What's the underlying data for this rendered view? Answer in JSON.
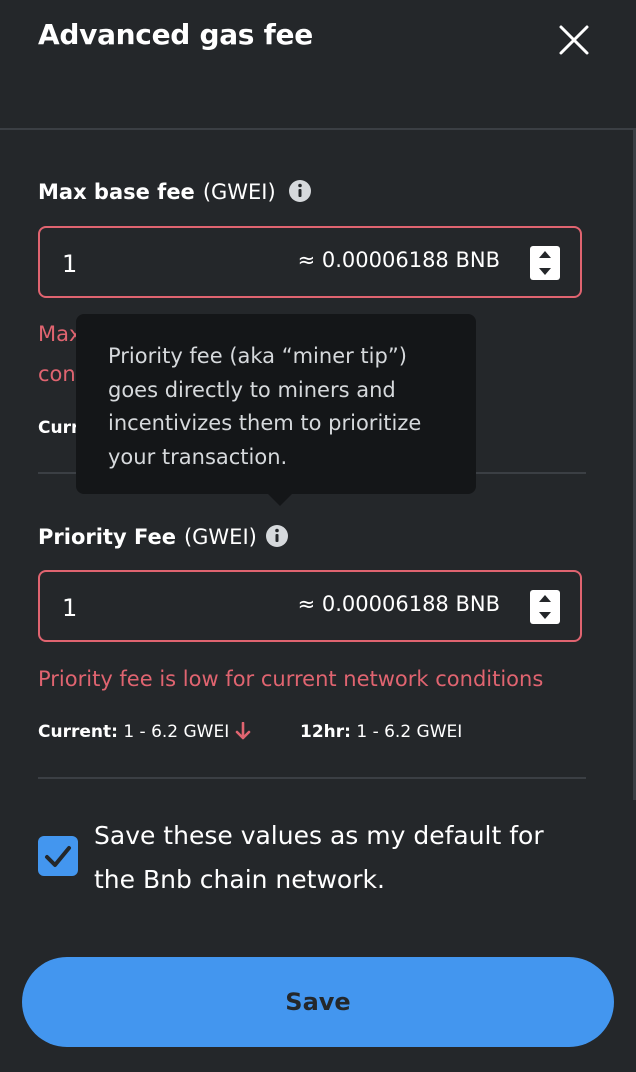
{
  "header": {
    "title": "Advanced gas fee"
  },
  "max_base_fee": {
    "label": "Max base fee",
    "unit": "(GWEI)",
    "value": "1",
    "conversion": "≈ 0.00006188 BNB",
    "error_visible_1": "Max",
    "error_visible_2": "con",
    "meta_visible": "Curr"
  },
  "tooltip": {
    "lines": [
      "Priority fee (aka “miner tip”)",
      "goes directly to miners and",
      "incentivizes them to prioritize",
      "your transaction."
    ]
  },
  "priority_fee": {
    "label": "Priority Fee",
    "unit": "(GWEI)",
    "value": "1",
    "conversion": "≈ 0.00006188 BNB",
    "error": "Priority fee is low for current network conditions",
    "current_label": "Current:",
    "current_value": "1 - 6.2 GWEI",
    "h12_label": "12hr:",
    "h12_value": "1 - 6.2 GWEI"
  },
  "default_checkbox": {
    "checked": true,
    "label_line1": "Save these values as my default for",
    "label_line2": "the Bnb chain network."
  },
  "save_button": {
    "label": "Save"
  },
  "icons": {
    "close": "close-icon",
    "info": "info-icon",
    "arrow_down": "arrow-down-icon",
    "check": "check-icon",
    "stepper_up": "chevron-up-icon",
    "stepper_down": "chevron-down-icon"
  },
  "colors": {
    "background": "#24272a",
    "error": "#e06470",
    "accent": "#4396ef",
    "tooltip_bg": "#141618",
    "divider": "#3b3f44"
  }
}
